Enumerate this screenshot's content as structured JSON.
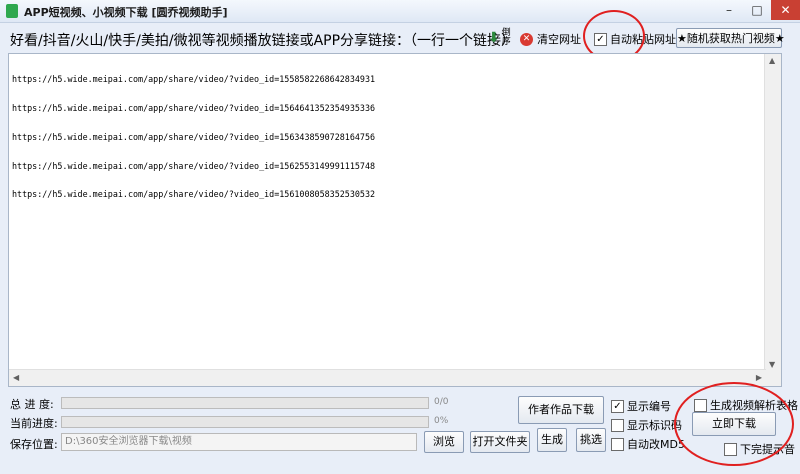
{
  "window": {
    "title": "APP短视频、小视频下载 [圆乔视频助手]",
    "controls": {
      "minimize": "–",
      "maximize": "□",
      "close": "✕"
    }
  },
  "toolbar": {
    "label": "好看/抖音/火山/快手/美拍/微视等视频播放链接或APP分享链接：（一行一个链接）",
    "sort_label": "倒序",
    "clear_label": "清空网址",
    "auto_paste_label": "自动粘贴网址",
    "auto_paste_checked": true,
    "hot_button": "★随机获取热门视频★"
  },
  "urls": [
    "https://h5.wide.meipai.com/app/share/video/?video_id=1558582268642834931",
    "https://h5.wide.meipai.com/app/share/video/?video_id=1564641352354935336",
    "https://h5.wide.meipai.com/app/share/video/?video_id=1563438590728164756",
    "https://h5.wide.meipai.com/app/share/video/?video_id=1562553149991115748",
    "https://h5.wide.meipai.com/app/share/video/?video_id=1561008058352530532"
  ],
  "progress": {
    "total_label": "总 进 度:",
    "total_value": "0/0",
    "total_fraction": 0,
    "current_label": "当前进度:",
    "current_value": "0%",
    "current_fraction": 0
  },
  "save": {
    "label": "保存位置:",
    "path": "D:\\360安全浏览器下载\\视频",
    "browse": "浏览",
    "open_folder": "打开文件夹"
  },
  "actions": {
    "author_download": "作者作品下载",
    "generate": "生成",
    "select": "挑选",
    "download_now": "立即下载"
  },
  "options": {
    "show_number": {
      "label": "显示编号",
      "checked": true
    },
    "show_watermark": {
      "label": "显示标识码",
      "checked": false
    },
    "auto_md5": {
      "label": "自动改MD5",
      "checked": false
    },
    "gen_table": {
      "label": "生成视频解析表格",
      "checked": false
    },
    "done_sound": {
      "label": "下完提示音",
      "checked": false
    }
  }
}
